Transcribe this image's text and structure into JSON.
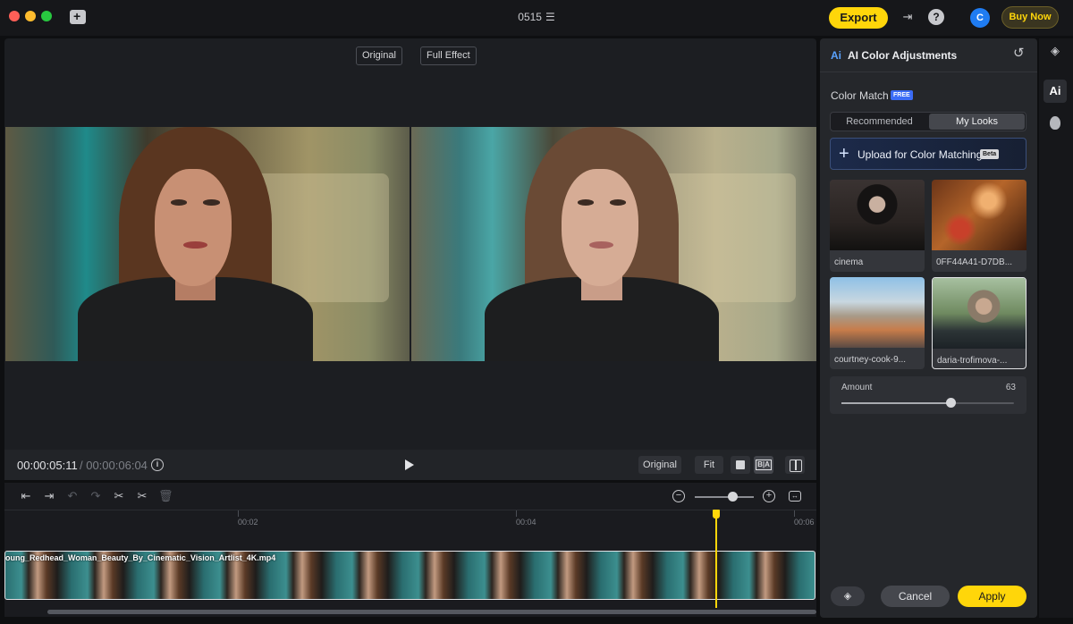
{
  "titlebar": {
    "project_name": "0515",
    "export_label": "Export",
    "avatar_letter": "C",
    "buy_label": "Buy Now"
  },
  "preview": {
    "toggle_original": "Original",
    "toggle_full_effect": "Full Effect"
  },
  "player": {
    "current_time": "00:00:05:11",
    "total_time": "/ 00:00:06:04",
    "original_btn": "Original",
    "fit_btn": "Fit",
    "ba_label": "B|A"
  },
  "timeline": {
    "ticks": [
      "00:02",
      "00:04",
      "00:06"
    ],
    "clip_name": "oung_Redhead_Woman_Beauty_By_Cinematic_Vision_Artlist_4K.mp4"
  },
  "panel": {
    "ai_logo": "Ai",
    "title": "AI Color Adjustments",
    "color_match_label": "Color Match",
    "free_badge": "FREE",
    "tab_recommended": "Recommended",
    "tab_my_looks": "My Looks",
    "upload_label": "Upload for Color Matching",
    "beta_badge": "Beta",
    "looks": [
      {
        "name": "cinema"
      },
      {
        "name": "0FF44A41-D7DB..."
      },
      {
        "name": "courtney-cook-9..."
      },
      {
        "name": "daria-trofimova-..."
      }
    ],
    "amount_label": "Amount",
    "amount_value": "63",
    "cancel_label": "Cancel",
    "apply_label": "Apply"
  },
  "rail": {
    "ai_label": "Ai"
  },
  "colors": {
    "accent_yellow": "#ffd60a",
    "avatar_blue": "#1f7cf2",
    "free_badge_blue": "#3b6cf6"
  },
  "state": {
    "selected_look_index": 3,
    "active_tab": "My Looks",
    "amount_percent": 63,
    "timeline_zoom_fraction": 0.64
  }
}
